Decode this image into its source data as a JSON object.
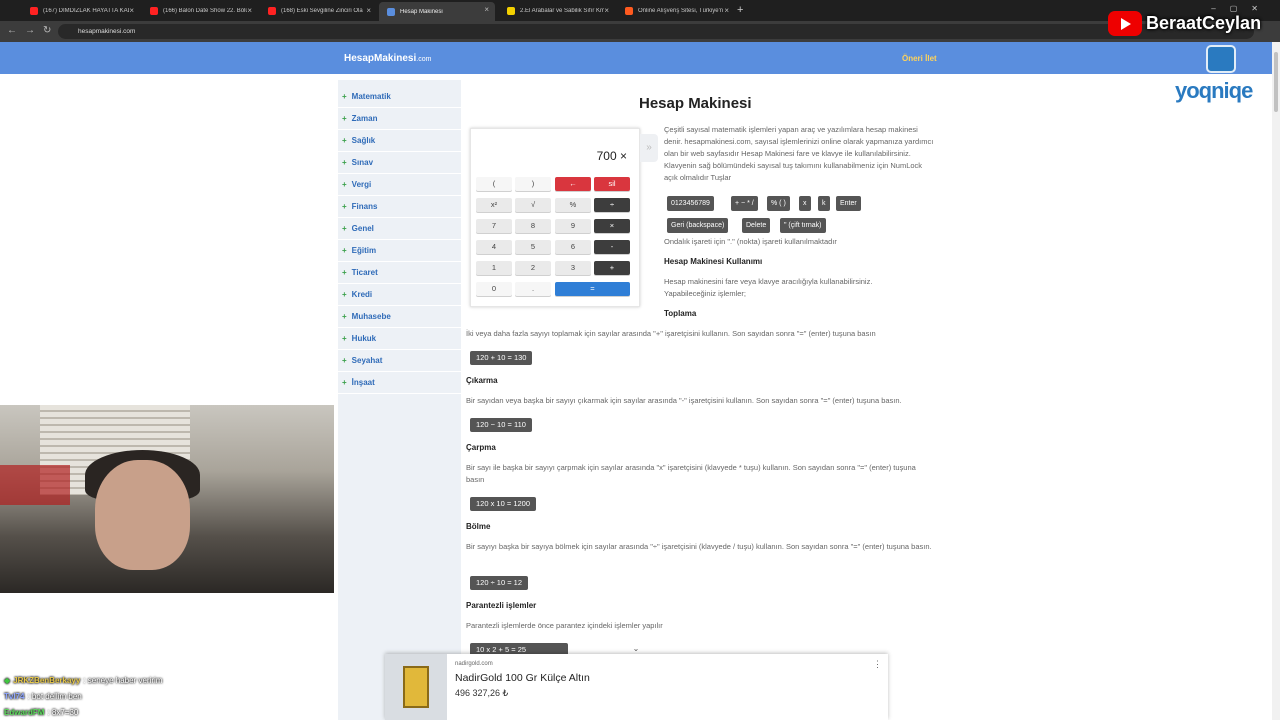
{
  "browser": {
    "tabs": [
      {
        "title": "(167) DIMDIZLAK HAYATTA KAL",
        "fav_color": "#ff2222",
        "active": false
      },
      {
        "title": "(166) Balon Date Show 22. Bölü",
        "fav_color": "#ff2222",
        "active": false
      },
      {
        "title": "(168) Eski Sevgiline Zinciri Ola",
        "fav_color": "#ff2222",
        "active": false
      },
      {
        "title": "Hesap Makinesi",
        "fav_color": "#5a8ede",
        "active": true
      },
      {
        "title": "2.El Arabalar ve Sabilik Sıfır Km",
        "fav_color": "#f3d000",
        "active": false
      },
      {
        "title": "Online Alışveriş Sitesi, Türkiye'n",
        "fav_color": "#ff5a1f",
        "active": false
      }
    ],
    "url": "hesapmakinesi.com"
  },
  "stream": {
    "channel": "BeraatCeylan",
    "watermark": "yoqniqe",
    "chat": [
      {
        "user": "JRKZBenBerkayy",
        "message": ": seneye haber veririm",
        "color": "#e6c84a"
      },
      {
        "user": "Tvl74",
        "message": ": bot dellim ben",
        "color": "#8fa6ff"
      },
      {
        "user": "EdwardFM",
        "message": ": 8x7=30",
        "color": "#5ddc5d"
      }
    ]
  },
  "site": {
    "logo": "HesapMakinesi",
    "logo_suffix": ".com",
    "suggest_link": "Öneri İlet",
    "sidebar": [
      "Matematik",
      "Zaman",
      "Sağlık",
      "Sınav",
      "Vergi",
      "Finans",
      "Genel",
      "Eğitim",
      "Ticaret",
      "Kredi",
      "Muhasebe",
      "Hukuk",
      "Seyahat",
      "İnşaat"
    ],
    "plus": "+",
    "title": "Hesap Makinesi",
    "intro": "Çeşitli sayısal matematik işlemleri yapan araç ve yazılımlara hesap makinesi denir. hesapmakinesi.com, sayısal işlemlerinizi online olarak yapmanıza yardımcı olan bir web sayfasıdır Hesap Makinesi fare ve klavye ile kullanılabilirsiniz. Klavyenin sağ bölümündeki sayısal tuş takımını kullanabilmeniz için NumLock açık olmalıdır Tuşlar",
    "key_buttons": [
      "0123456789",
      "+ − * /",
      "% ( )",
      "x",
      "k",
      "Enter",
      "Geri (backspace)",
      "Delete",
      "\" (çift tırnak)"
    ],
    "decimal_note": "Ondalık işareti için \".\" (nokta) işareti kullanılmaktadır",
    "usage_title": "Hesap Makinesi Kullanımı",
    "usage_text": "Hesap makinesini fare veya klavye aracılığıyla kullanabilirsiniz. Yapabileceğiniz işlemler;",
    "sections": [
      {
        "title": "Toplama",
        "text": "İki veya daha fazla sayıyı toplamak için sayılar arasında \"+\" işaretçisini kullanın. Son sayıdan sonra \"=\" (enter) tuşuna basın",
        "example": "120 + 10 = 130"
      },
      {
        "title": "Çıkarma",
        "text": "Bir sayıdan veya başka bir sayıyı çıkarmak için sayılar arasında \"-\" işaretçisini kullanın. Son sayıdan sonra \"=\" (enter) tuşuna basın.",
        "example": "120 − 10 = 110"
      },
      {
        "title": "Çarpma",
        "text": "Bir sayı ile başka bir sayıyı çarpmak için sayılar arasında \"x\" işaretçisini (klavyede * tuşu) kullanın. Son sayıdan sonra \"=\" (enter) tuşuna basın",
        "example": "120 x 10 = 1200"
      },
      {
        "title": "Bölme",
        "text": "Bir sayıyı başka bir sayıya bölmek için sayılar arasında \"÷\" işaretçisini (klavyede / tuşu) kullanın. Son sayıdan sonra \"=\" (enter) tuşuna basın.",
        "example": "120 ÷ 10 = 12"
      },
      {
        "title": "Parantezli işlemler",
        "text": "Parantezli işlemlerde önce parantez içindeki işlemler yapılır",
        "example": "10 x 2 + 5 = 25"
      }
    ]
  },
  "calculator": {
    "display": "700",
    "clear_symbol": "×",
    "keys": [
      [
        "(",
        ")",
        "←",
        "sil"
      ],
      [
        "x²",
        "√",
        "%",
        "÷"
      ],
      [
        "7",
        "8",
        "9",
        "×"
      ],
      [
        "4",
        "5",
        "6",
        "-"
      ],
      [
        "1",
        "2",
        "3",
        "+"
      ],
      [
        "0",
        ".",
        "="
      ]
    ],
    "toggle": "»"
  },
  "ad": {
    "domain": "nadirgold.com",
    "title": "NadirGold 100 Gr Külçe Altın",
    "price": "496 327,26 ₺",
    "more": "⋮",
    "toggle": "⌄"
  }
}
